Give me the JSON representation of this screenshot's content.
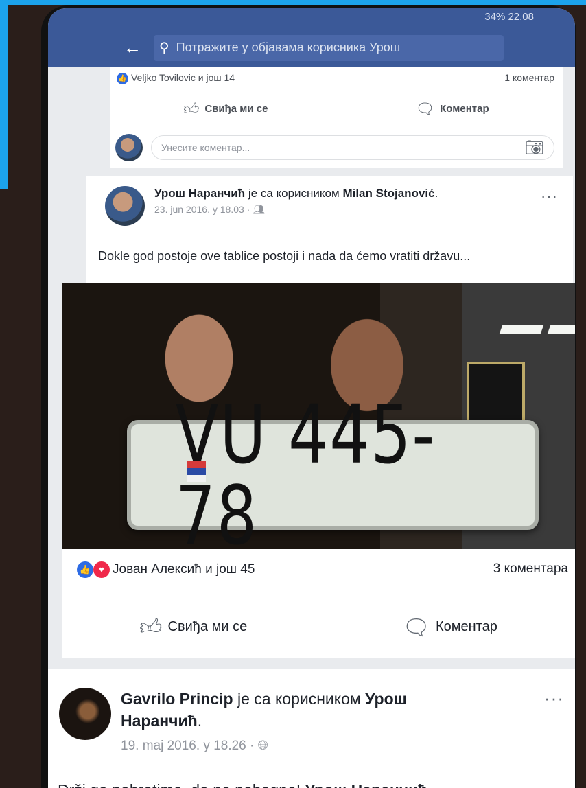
{
  "status_bar": {
    "text": "34% 22.08"
  },
  "search": {
    "placeholder": "Потражите у објавама корисника Урош"
  },
  "top_card": {
    "reactions_text": "Veljko Tovilovic и још 14",
    "comments_count": "1 коментар",
    "like_label": "Свиђа ми се",
    "comment_label": "Коментар",
    "comment_placeholder": "Унесите коментар..."
  },
  "post1": {
    "author": "Урош Наранчић",
    "with_text": "је са корисником",
    "tagged": "Milan Stojanović",
    "date": "23. jun 2016. у 18.03 ·",
    "text": "Dokle god postoje ove tablice postoji i nada da ćemo vratiti državu...",
    "plate_text": "VU 445-78",
    "reactions_text": "Јован Алексић и још 45",
    "comments_count": "3 коментара",
    "like_label": "Свиђа ми се",
    "comment_label": "Коментар"
  },
  "post2": {
    "author": "Gavrilo Princip",
    "with_text": "је са корисником",
    "tagged": "Урош Наранчић",
    "date": "19. maj 2016. у 18.26 ·",
    "text_start": "Drži ga pobratime, da ne pobegne!",
    "text_tag": "Урош Наранчић"
  },
  "colors": {
    "brand": "#3b5998",
    "like_blue": "#2d6be4",
    "heart_red": "#f0284a"
  },
  "icons": [
    "back-arrow-icon",
    "search-icon",
    "like-icon",
    "heart-icon",
    "thumbs-up-icon",
    "comment-icon",
    "camera-icon",
    "more-icon",
    "friends-icon",
    "globe-icon"
  ]
}
